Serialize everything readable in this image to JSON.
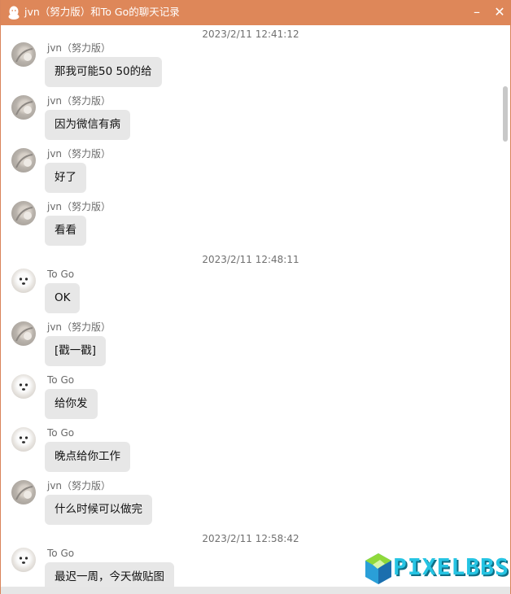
{
  "window": {
    "title": "jvn（努力版）和To Go的聊天记录",
    "minimize_label": "–",
    "close_label": "✕",
    "accent_color": "#de8759"
  },
  "timestamps": [
    "2023/2/11 12:41:12",
    "2023/2/11 12:48:11",
    "2023/2/11 12:58:42"
  ],
  "messages": [
    {
      "sender": "jvn（努力版）",
      "text": "那我可能50 50的给"
    },
    {
      "sender": "jvn（努力版）",
      "text": "因为微信有病"
    },
    {
      "sender": "jvn（努力版）",
      "text": "好了"
    },
    {
      "sender": "jvn（努力版）",
      "text": "看看"
    },
    {
      "sender": "To Go",
      "text": "OK"
    },
    {
      "sender": "jvn（努力版）",
      "text": "[戳一戳]"
    },
    {
      "sender": "To Go",
      "text": " 给你发"
    },
    {
      "sender": "To Go",
      "text": "晚点给你工作"
    },
    {
      "sender": "jvn（努力版）",
      "text": "什么时候可以做完"
    },
    {
      "sender": "To Go",
      "text": "最迟一周，今天做贴图"
    }
  ],
  "watermark": {
    "text": "PIXELBBS"
  }
}
